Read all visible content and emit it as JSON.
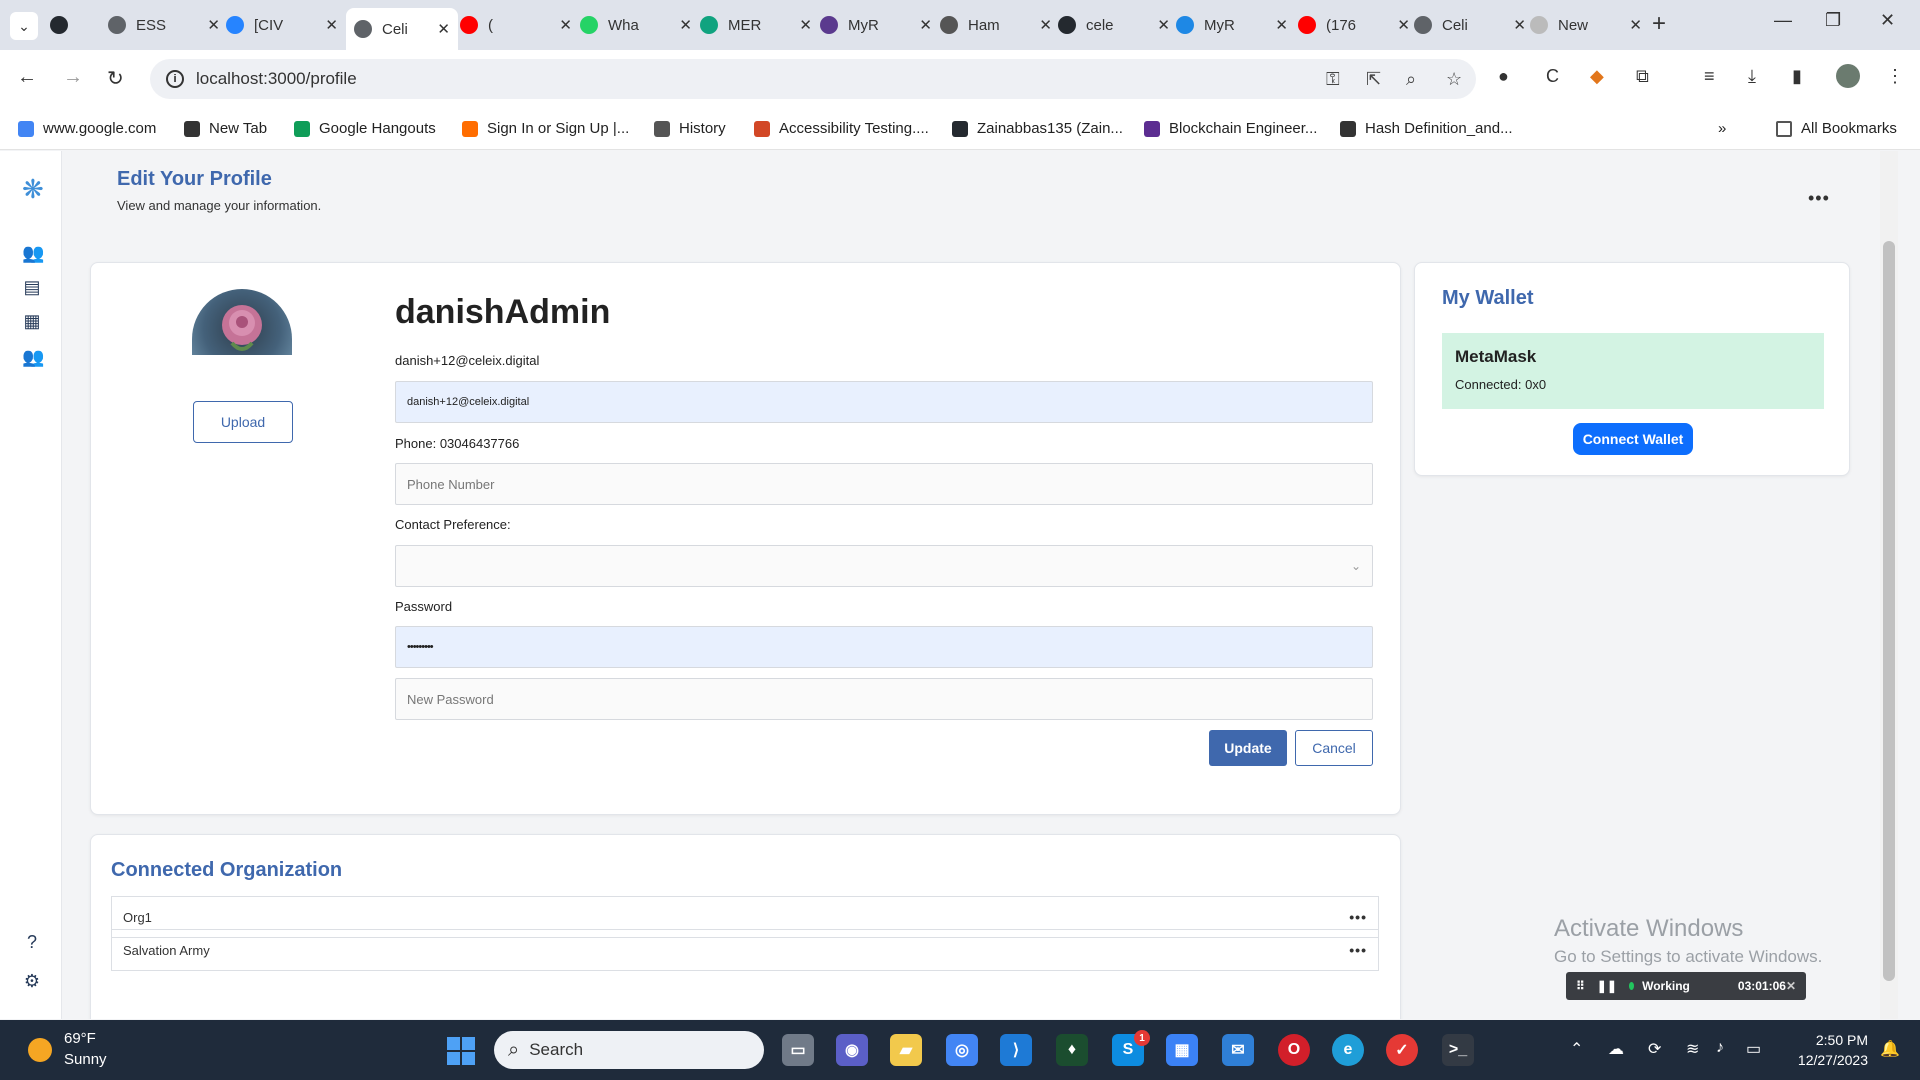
{
  "browser": {
    "tabs": [
      {
        "title": "",
        "color": "#24292f"
      },
      {
        "title": "ESS",
        "color": "#5f6368"
      },
      {
        "title": "[CIV",
        "color": "#2684ff"
      },
      {
        "title": "Celi",
        "color": "#5f6368"
      },
      {
        "title": "(",
        "color": "#ff0000"
      },
      {
        "title": "Wha",
        "color": "#25d366"
      },
      {
        "title": "MER",
        "color": "#10a37f"
      },
      {
        "title": "MyR",
        "color": "#5b3a8e"
      },
      {
        "title": "Ham",
        "color": "#555555"
      },
      {
        "title": "cele",
        "color": "#24292f"
      },
      {
        "title": "MyR",
        "color": "#1e88e5"
      },
      {
        "title": "(176",
        "color": "#ff0000"
      },
      {
        "title": "Celi",
        "color": "#5f6368"
      },
      {
        "title": "New",
        "color": "#bbbbbb"
      }
    ],
    "url": "localhost:3000/profile",
    "bookmarks": [
      {
        "label": "www.google.com",
        "color": "#4285f4"
      },
      {
        "label": "New Tab",
        "color": "#333333"
      },
      {
        "label": "Google Hangouts",
        "color": "#0f9d58"
      },
      {
        "label": "Sign In or Sign Up |...",
        "color": "#ff6d00"
      },
      {
        "label": "History",
        "color": "#555555"
      },
      {
        "label": "Accessibility Testing....",
        "color": "#d24726"
      },
      {
        "label": "Zainabbas135 (Zain...",
        "color": "#24292f"
      },
      {
        "label": "Blockchain Engineer...",
        "color": "#5c2d91"
      },
      {
        "label": "Hash Definition_and...",
        "color": "#333333"
      }
    ],
    "all_bookmarks": "All Bookmarks"
  },
  "page": {
    "title": "Edit Your Profile",
    "subtitle": "View and manage your information."
  },
  "profile": {
    "upload_label": "Upload",
    "username": "danishAdmin",
    "email_label": "danish+12@celeix.digital",
    "email_value": "danish+12@celeix.digital",
    "phone_label": "Phone: 03046437766",
    "phone_placeholder": "Phone Number",
    "contact_pref_label": "Contact Preference:",
    "contact_pref_value": "",
    "password_label": "Password",
    "password_value": "•••••••••",
    "new_password_placeholder": "New Password",
    "update_label": "Update",
    "cancel_label": "Cancel"
  },
  "wallet": {
    "title": "My Wallet",
    "provider": "MetaMask",
    "status": "Connected: 0x0",
    "connect_label": "Connect Wallet"
  },
  "organizations": {
    "title": "Connected Organization",
    "items": [
      {
        "name": "Org1"
      },
      {
        "name": "Salvation Army"
      }
    ]
  },
  "overlay": {
    "activate_title": "Activate Windows",
    "activate_sub": "Go to Settings to activate Windows.",
    "timer_status": "Working",
    "timer_time": "03:01:06"
  },
  "taskbar": {
    "temp": "69°F",
    "condition": "Sunny",
    "search": "Search",
    "time": "2:50 PM",
    "date": "12/27/2023",
    "skype_badge": "1"
  },
  "colors": {
    "accent": "#3f68ad",
    "wallet_bg": "#d3f3e3",
    "connect_btn": "#0d6efd"
  }
}
